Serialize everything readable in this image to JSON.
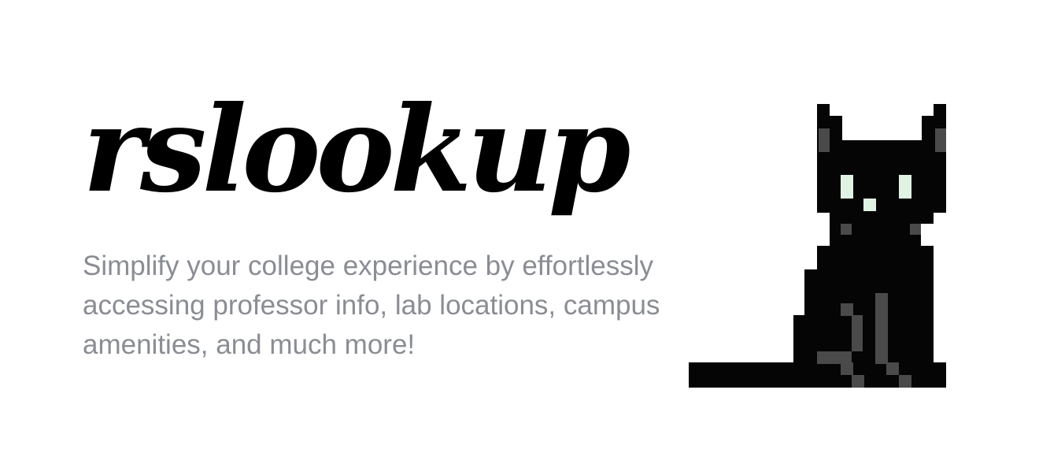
{
  "brand": {
    "title": "rslookup"
  },
  "hero": {
    "tagline": "Simplify your college experience by effortlessly accessing professor info, lab locations, campus amenities, and much more!"
  },
  "mascot": {
    "icon": "pixel-black-cat-icon"
  },
  "colors": {
    "background": "#ffffff",
    "title": "#000000",
    "tagline": "#8a8d93",
    "cat_body": "#050505",
    "cat_shade": "#4a4a4a",
    "cat_eyes": "#dff2e3"
  }
}
